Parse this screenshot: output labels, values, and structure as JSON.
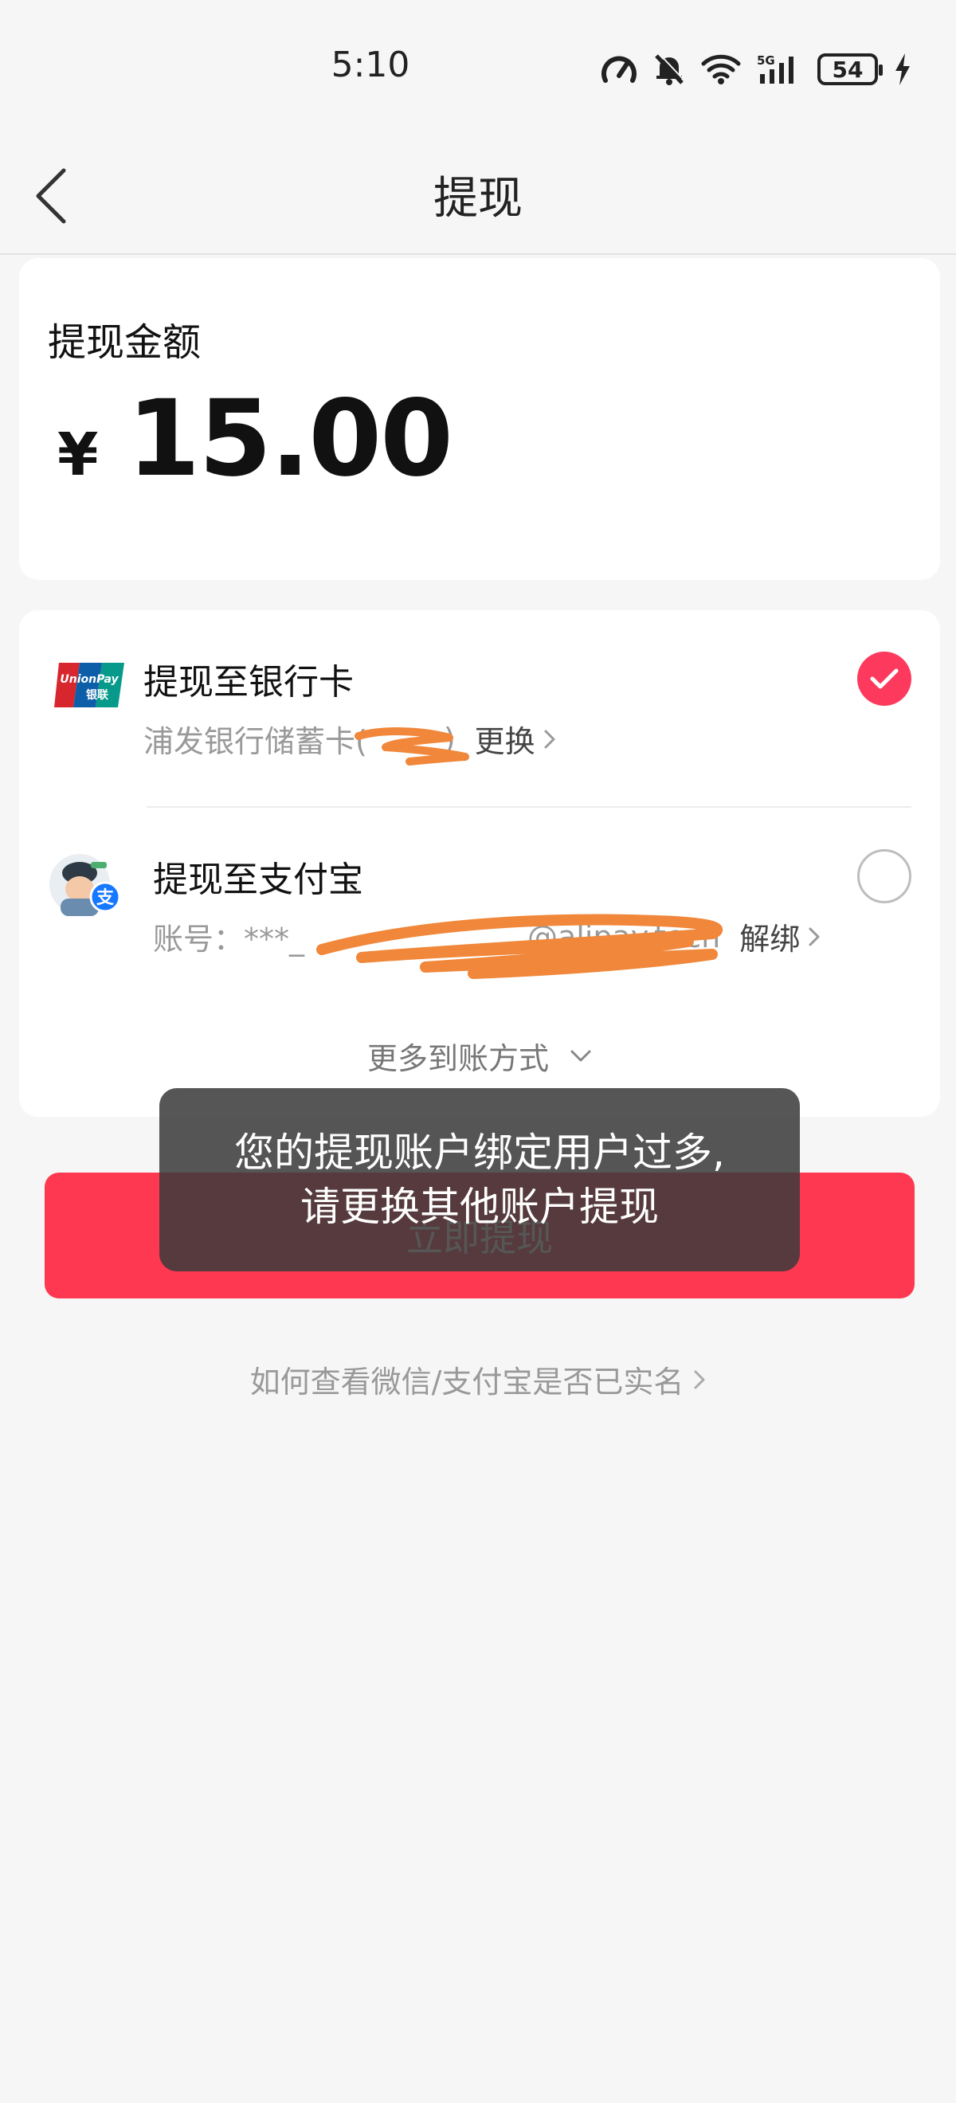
{
  "status_bar": {
    "time": "5:10",
    "battery": "54",
    "icons": [
      "speedometer-icon",
      "bell-muted-icon",
      "wifi-icon",
      "signal-5g-icon",
      "battery-icon",
      "charging-icon"
    ]
  },
  "header": {
    "title": "提现",
    "back_icon": "chevron-left-icon"
  },
  "amount_card": {
    "label": "提现金额",
    "currency": "¥",
    "amount": "15.00"
  },
  "methods": {
    "bank": {
      "title": "提现至银行卡",
      "account": "浦发银行储蓄卡(",
      "account_suffix": ")",
      "action": "更换",
      "selected": true,
      "icon": "unionpay-logo"
    },
    "alipay": {
      "title": "提现至支付宝",
      "account": "账号：***_",
      "account_suffix": "@alipay.tech",
      "action": "解绑",
      "selected": false,
      "icon": "alipay-avatar"
    },
    "more": "更多到账方式"
  },
  "primary_button": {
    "label": "立即提现"
  },
  "toast": {
    "line1": "您的提现账户绑定用户过多,",
    "line2": "请更换其他账户提现"
  },
  "help_link": "如何查看微信/支付宝是否已实名",
  "colors": {
    "accent": "#fd3850",
    "background": "#f6f6f6",
    "card": "#ffffff",
    "redaction": "#f0873a"
  }
}
